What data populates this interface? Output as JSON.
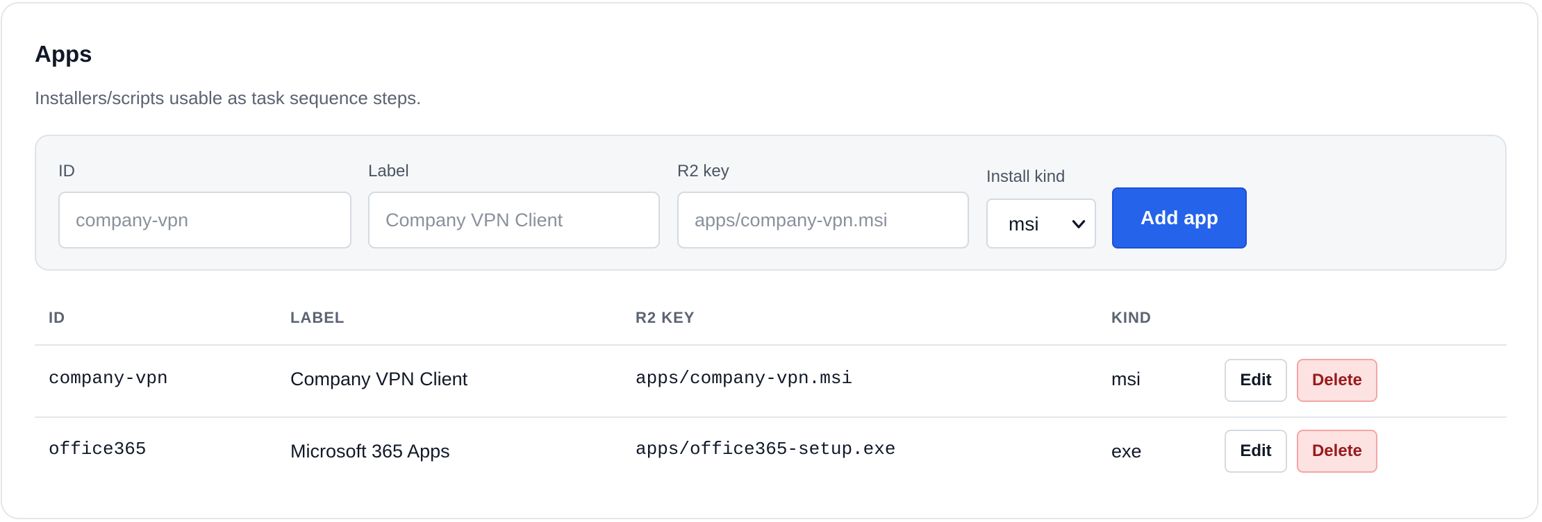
{
  "section": {
    "title": "Apps",
    "subtitle": "Installers/scripts usable as task sequence steps."
  },
  "form": {
    "id": {
      "label": "ID",
      "placeholder": "company-vpn",
      "value": ""
    },
    "label": {
      "label": "Label",
      "placeholder": "Company VPN Client",
      "value": ""
    },
    "r2_key": {
      "label": "R2 key",
      "placeholder": "apps/company-vpn.msi",
      "value": ""
    },
    "install_kind": {
      "label": "Install kind",
      "selected": "msi",
      "icon": "chevron-down-icon"
    },
    "submit_label": "Add app",
    "accent_color": "#2563eb"
  },
  "table": {
    "columns": [
      "ID",
      "LABEL",
      "R2 KEY",
      "KIND"
    ],
    "rows": [
      {
        "id": "company-vpn",
        "label": "Company VPN Client",
        "r2_key": "apps/company-vpn.msi",
        "kind": "msi",
        "edit_label": "Edit",
        "delete_label": "Delete"
      },
      {
        "id": "office365",
        "label": "Microsoft 365 Apps",
        "r2_key": "apps/office365-setup.exe",
        "kind": "exe",
        "edit_label": "Edit",
        "delete_label": "Delete"
      }
    ],
    "delete_color": "#991b1b"
  }
}
